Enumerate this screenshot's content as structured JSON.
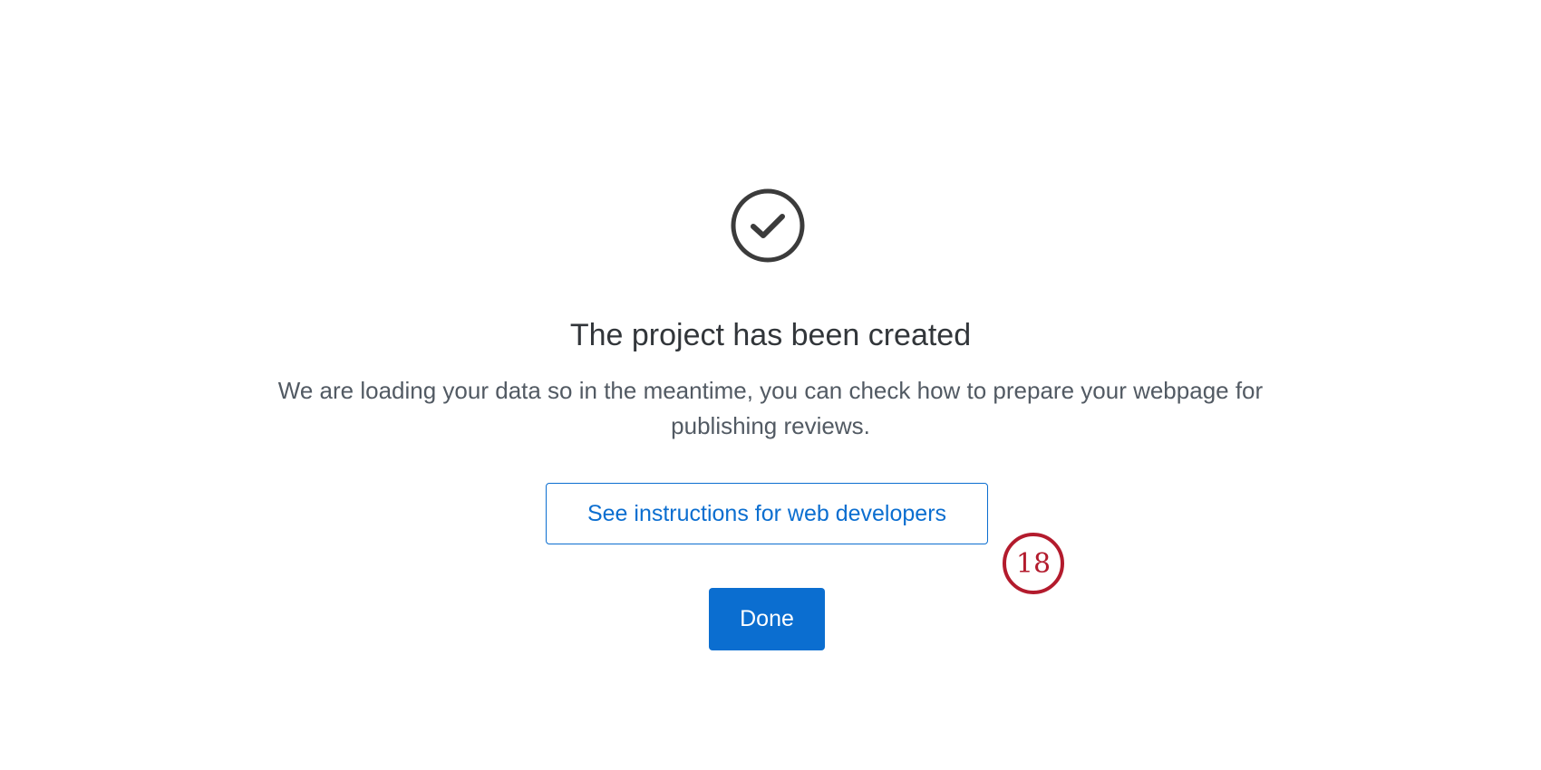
{
  "success": {
    "icon": "check-circle-icon",
    "title": "The project has been created",
    "message": "We are loading your data so in the meantime, you can check how to prepare your webpage for publishing reviews."
  },
  "actions": {
    "instructions_label": "See instructions for web developers",
    "done_label": "Done"
  },
  "annotation": {
    "step_number": "18"
  },
  "colors": {
    "accent": "#0b6ed0",
    "text": "#32363a",
    "muted_text": "#525a63",
    "annotation": "#b31b2d"
  }
}
